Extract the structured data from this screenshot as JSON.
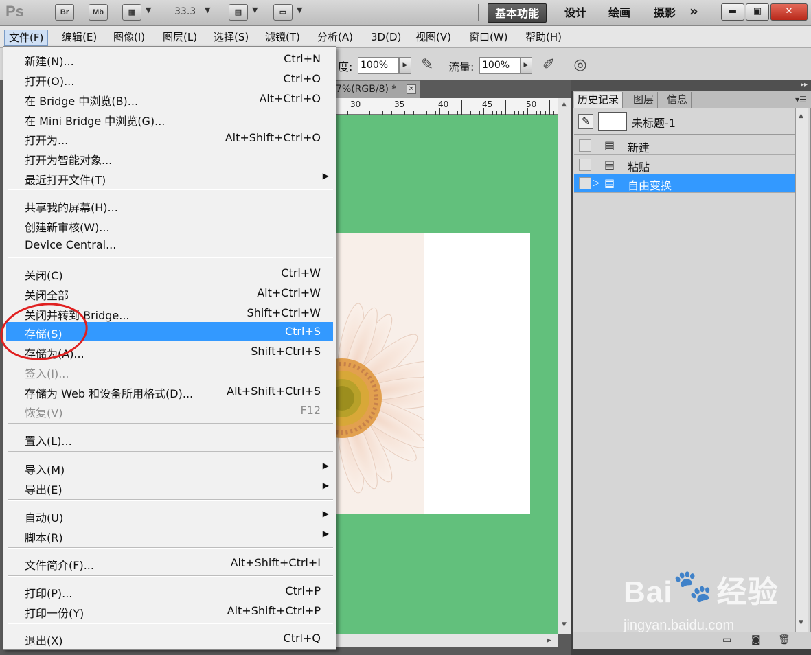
{
  "app": {
    "logo": "Ps",
    "zoom": "33.3",
    "icons": [
      "bridge-icon",
      "mini-bridge-icon",
      "view-extras-icon",
      "arrange-documents-icon",
      "screen-mode-icon"
    ],
    "tb_br": "Br",
    "tb_mb": "Mb"
  },
  "workspaces": {
    "essentials": "基本功能",
    "design": "设计",
    "painting": "绘画",
    "photography": "摄影",
    "more": "»"
  },
  "menubar": [
    "文件(F)",
    "编辑(E)",
    "图像(I)",
    "图层(L)",
    "选择(S)",
    "滤镜(T)",
    "分析(A)",
    "3D(D)",
    "视图(V)",
    "窗口(W)",
    "帮助(H)"
  ],
  "options": {
    "opacity_label": "度:",
    "opacity_value": "100%",
    "flow_label": "流量:",
    "flow_value": "100%"
  },
  "document": {
    "tab_title": "7%(RGB/8) *",
    "ruler_labels": [
      "30",
      "35",
      "40",
      "45",
      "50"
    ],
    "canvas_color": "#62c07c"
  },
  "file_menu": {
    "items": [
      {
        "label": "新建(N)...",
        "shortcut": "Ctrl+N"
      },
      {
        "label": "打开(O)...",
        "shortcut": "Ctrl+O"
      },
      {
        "label": "在 Bridge 中浏览(B)...",
        "shortcut": "Alt+Ctrl+O"
      },
      {
        "label": "在 Mini Bridge 中浏览(G)...",
        "shortcut": ""
      },
      {
        "label": "打开为...",
        "shortcut": "Alt+Shift+Ctrl+O"
      },
      {
        "label": "打开为智能对象...",
        "shortcut": ""
      },
      {
        "label": "最近打开文件(T)",
        "shortcut": ""
      },
      {
        "label": "共享我的屏幕(H)...",
        "shortcut": ""
      },
      {
        "label": "创建新审核(W)...",
        "shortcut": ""
      },
      {
        "label": "Device Central...",
        "shortcut": ""
      },
      {
        "label": "关闭(C)",
        "shortcut": "Ctrl+W"
      },
      {
        "label": "关闭全部",
        "shortcut": "Alt+Ctrl+W"
      },
      {
        "label": "关闭并转到 Bridge...",
        "shortcut": "Shift+Ctrl+W"
      },
      {
        "label": "存储(S)",
        "shortcut": "Ctrl+S"
      },
      {
        "label": "存储为(A)...",
        "shortcut": "Shift+Ctrl+S"
      },
      {
        "label": "签入(I)...",
        "shortcut": ""
      },
      {
        "label": "存储为 Web 和设备所用格式(D)...",
        "shortcut": "Alt+Shift+Ctrl+S"
      },
      {
        "label": "恢复(V)",
        "shortcut": "F12"
      },
      {
        "label": "置入(L)...",
        "shortcut": ""
      },
      {
        "label": "导入(M)",
        "shortcut": ""
      },
      {
        "label": "导出(E)",
        "shortcut": ""
      },
      {
        "label": "自动(U)",
        "shortcut": ""
      },
      {
        "label": "脚本(R)",
        "shortcut": ""
      },
      {
        "label": "文件简介(F)...",
        "shortcut": "Alt+Shift+Ctrl+I"
      },
      {
        "label": "打印(P)...",
        "shortcut": "Ctrl+P"
      },
      {
        "label": "打印一份(Y)",
        "shortcut": "Alt+Shift+Ctrl+P"
      },
      {
        "label": "退出(X)",
        "shortcut": "Ctrl+Q"
      }
    ]
  },
  "history_panel": {
    "tabs": [
      "历史记录",
      "图层",
      "信息"
    ],
    "snapshot": "未标题-1",
    "states": [
      "新建",
      "粘贴",
      "自由变换"
    ],
    "selected_state": "自由变换"
  },
  "watermark": {
    "logo": "Bai",
    "logo_suffix": "经验",
    "url": "jingyan.baidu.com"
  },
  "colors": {
    "highlight": "#3399ff",
    "annotation": "#e02020"
  }
}
